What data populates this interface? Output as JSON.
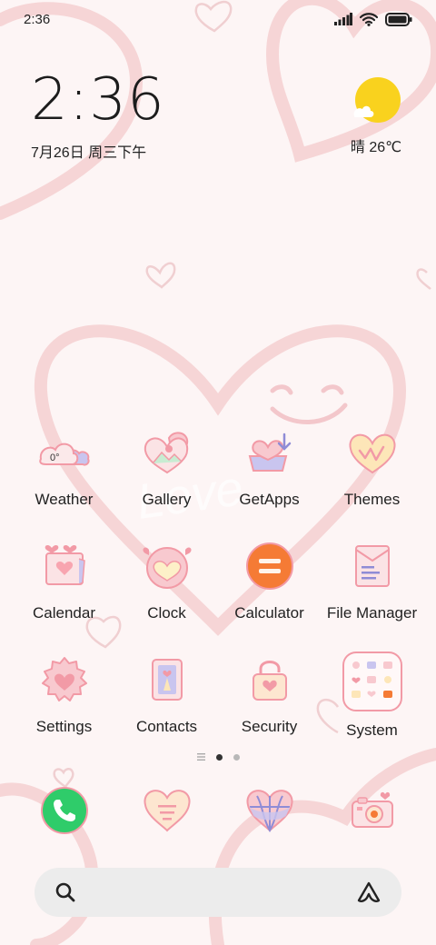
{
  "status_bar": {
    "time": "2:36",
    "icons": [
      "signal-icon",
      "wifi-icon",
      "battery-icon"
    ]
  },
  "clock_widget": {
    "time": "2:36",
    "date": "7月26日 周三下午"
  },
  "weather_widget": {
    "icon": "sun-cloud-icon",
    "summary": "晴 26℃"
  },
  "apps": [
    {
      "label": "Weather",
      "icon": "weather-icon",
      "icon_text": "0°"
    },
    {
      "label": "Gallery",
      "icon": "gallery-icon"
    },
    {
      "label": "GetApps",
      "icon": "getapps-icon"
    },
    {
      "label": "Themes",
      "icon": "themes-icon"
    },
    {
      "label": "Calendar",
      "icon": "calendar-icon"
    },
    {
      "label": "Clock",
      "icon": "clock-icon"
    },
    {
      "label": "Calculator",
      "icon": "calculator-icon"
    },
    {
      "label": "File Manager",
      "icon": "file-manager-icon"
    },
    {
      "label": "Settings",
      "icon": "settings-icon"
    },
    {
      "label": "Contacts",
      "icon": "contacts-icon"
    },
    {
      "label": "Security",
      "icon": "security-icon"
    },
    {
      "label": "System",
      "icon": "system-folder-icon"
    }
  ],
  "pager": {
    "pages": 3,
    "active_page": 2
  },
  "dock": [
    {
      "icon": "phone-icon"
    },
    {
      "icon": "messages-icon"
    },
    {
      "icon": "browser-icon"
    },
    {
      "icon": "camera-icon"
    }
  ],
  "search_bar": {
    "left_icon": "search-icon",
    "right_icon": "assistant-icon"
  },
  "colors": {
    "background": "#fdf5f5",
    "accent_pink": "#f29aa6",
    "light_pink": "#f8c9cf",
    "lavender": "#c9c5ef",
    "sun_yellow": "#f9d21e",
    "calculator_orange": "#f57b35",
    "phone_green": "#2fcc6a"
  }
}
